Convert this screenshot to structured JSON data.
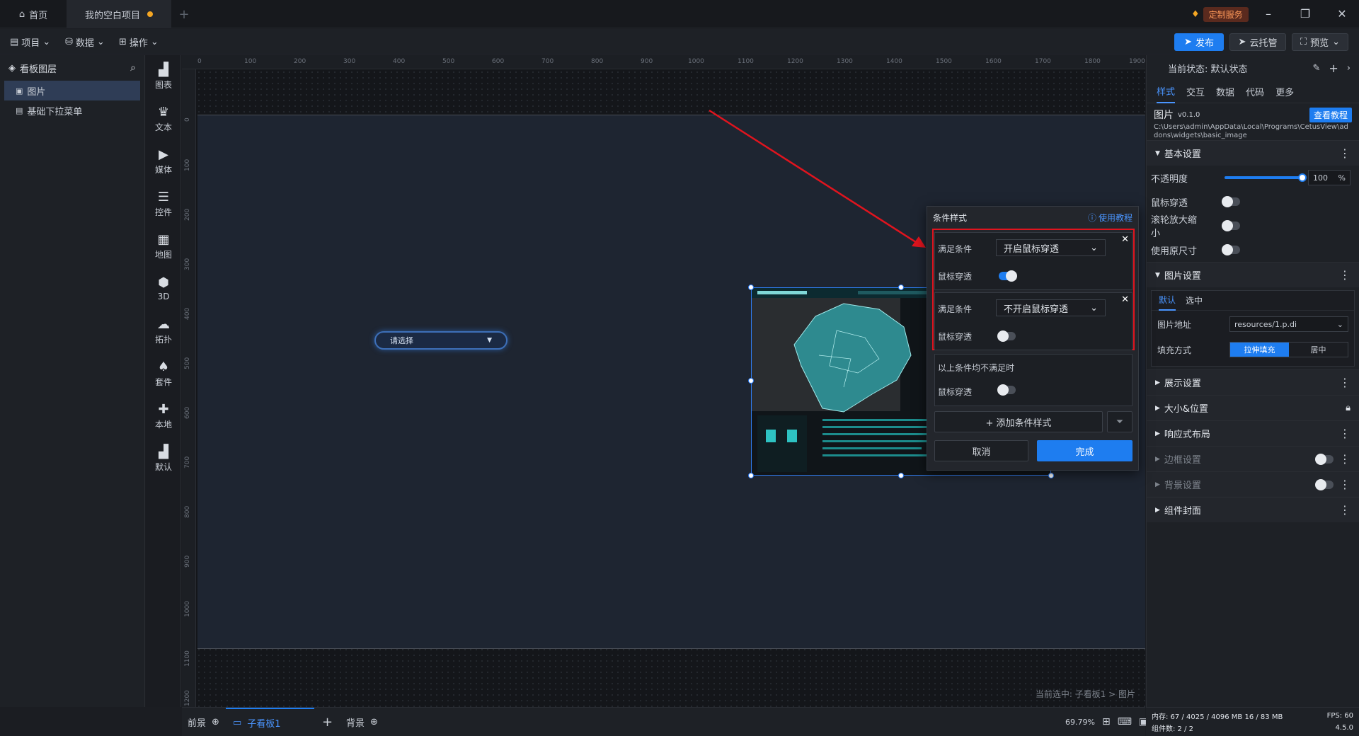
{
  "titlebar": {
    "home_label": "首页",
    "project_tab": "我的空白项目",
    "add_tab": "+",
    "custom_service": "定制服务"
  },
  "toolbar": {
    "menus": [
      "项目",
      "数据",
      "操作"
    ],
    "publish": "发布",
    "cloud": "云托管",
    "preview": "预览"
  },
  "layers": {
    "title": "看板图层",
    "items": [
      "图片",
      "基础下拉菜单"
    ]
  },
  "components": [
    "图表",
    "文本",
    "媒体",
    "控件",
    "地图",
    "3D",
    "拓扑",
    "套件",
    "本地",
    "默认"
  ],
  "canvas": {
    "ruler_x": [
      "0",
      "100",
      "200",
      "300",
      "400",
      "500",
      "600",
      "700",
      "800",
      "900",
      "1000",
      "1100",
      "1200",
      "1300",
      "1400",
      "1500",
      "1600",
      "1700",
      "1800",
      "1900"
    ],
    "ruler_y": [
      "0",
      "100",
      "200",
      "300",
      "400",
      "500",
      "600",
      "700",
      "800",
      "900",
      "1000",
      "1100",
      "1200"
    ],
    "dropdown_placeholder": "请选择",
    "breadcrumb": "当前选中: 子看板1 > 图片"
  },
  "bottombar": {
    "tabs": [
      "前景",
      "子看板1",
      "背景"
    ],
    "zoom": "69.79%"
  },
  "right_panel": {
    "state": "当前状态:  默认状态",
    "tabs": [
      "样式",
      "交互",
      "数据",
      "代码",
      "更多"
    ],
    "widget_name": "图片",
    "widget_version": "v0.1.0",
    "tutorial_btn": "查看教程",
    "path": "C:\\Users\\admin\\AppData\\Local\\Programs\\CetusView\\addons\\widgets\\basic_image",
    "basic_settings": "基本设置",
    "opacity_label": "不透明度",
    "opacity_value": "100",
    "opacity_unit": "%",
    "opacity_fraction": 1.0,
    "mouse_through": "鼠标穿透",
    "wheel_zoom": "滚轮放大缩小",
    "original_size": "使用原尺寸",
    "image_settings": "图片设置",
    "state_tabs": [
      "默认",
      "选中"
    ],
    "image_url_label": "图片地址",
    "image_url_value": "resources/1.p.di",
    "fill_mode_label": "填充方式",
    "fill_modes": [
      "拉伸填充",
      "居中"
    ],
    "sections": [
      "展示设置",
      "大小&位置",
      "响应式布局",
      "边框设置",
      "背景设置",
      "组件封面"
    ],
    "memory": "内存:  67 / 4025 / 4096 MB  16 / 83 MB",
    "fps": "FPS:  60",
    "components_count": "组件数: 2 / 2",
    "version": "4.5.0"
  },
  "popup": {
    "title": "条件样式",
    "help": "使用教程",
    "cond_label": "满足条件",
    "cond1_value": "开启鼠标穿透",
    "cond2_value": "不开启鼠标穿透",
    "mouse_label": "鼠标穿透",
    "else_label": "以上条件均不满足时",
    "add_btn": "+ 添加条件样式",
    "cancel": "取消",
    "done": "完成"
  },
  "colors": {
    "accent": "#1e7df0",
    "highlight_box": "#e0141e",
    "arrow": "#e0141e"
  }
}
